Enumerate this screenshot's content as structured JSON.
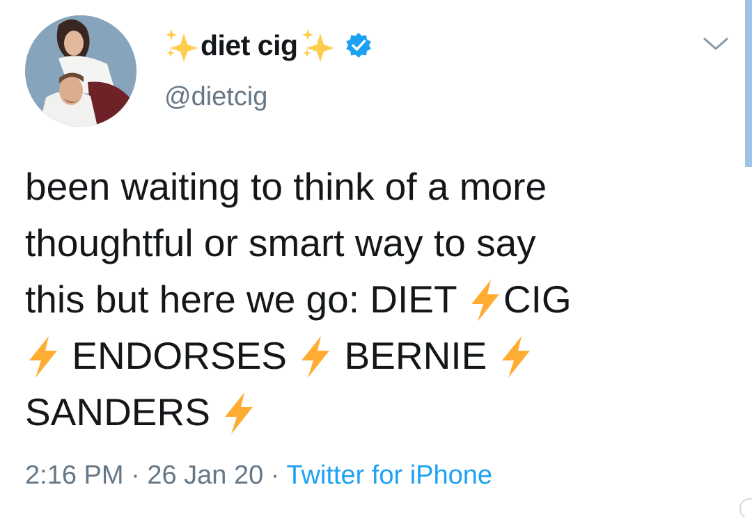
{
  "tweet": {
    "author": {
      "display_name": "diet cig",
      "name_emoji": "sparkles-icon",
      "verified": true,
      "verified_icon": "verified-badge-icon",
      "handle": "@dietcig",
      "avatar": "avatar"
    },
    "menu_icon": "chevron-down-icon",
    "text_lines": [
      [
        "been waiting to think of a more"
      ],
      [
        "thoughtful or smart way to say"
      ],
      [
        "this but here we go: DIET ",
        "⚡",
        "CIG"
      ],
      [
        "⚡",
        " ENDORSES ",
        "⚡",
        " BERNIE ",
        "⚡"
      ],
      [
        "SANDERS ",
        "⚡"
      ]
    ],
    "time": "2:16 PM",
    "separator": " · ",
    "date": "26 Jan 20",
    "source": "Twitter for iPhone"
  },
  "colors": {
    "text": "#14171a",
    "secondary": "#657786",
    "link": "#1da1f2",
    "bolt": "#ffac33",
    "sparkle": "#ffcc4d"
  }
}
